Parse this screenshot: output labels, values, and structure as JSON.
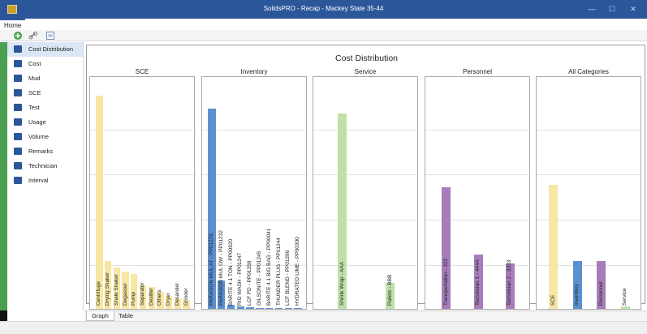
{
  "window": {
    "title": "SolidsPRO - Recap - Mackey State 35-44",
    "minimize": "—",
    "maximize": "☐",
    "close": "✕"
  },
  "ribbon": {
    "tab": "Home"
  },
  "toolbar": {
    "icons": [
      "add-icon",
      "link-icon",
      "view-icon"
    ]
  },
  "sidebar": {
    "items": [
      {
        "label": "Cost Distribution",
        "icon": "cost-distribution-icon",
        "color": "#2b579a",
        "selected": true
      },
      {
        "label": "Cost",
        "icon": "cost-icon",
        "color": "#2b579a",
        "selected": false
      },
      {
        "label": "Mud",
        "icon": "mud-funnel-icon",
        "color": "#2b579a",
        "selected": false
      },
      {
        "label": "SCE",
        "icon": "sce-grid-icon",
        "color": "#2b579a",
        "selected": false
      },
      {
        "label": "Test",
        "icon": "test-icon",
        "color": "#2b579a",
        "selected": false
      },
      {
        "label": "Usage",
        "icon": "usage-icon",
        "color": "#2b579a",
        "selected": false
      },
      {
        "label": "Volume",
        "icon": "volume-icon",
        "color": "#2b579a",
        "selected": false
      },
      {
        "label": "Remarks",
        "icon": "remarks-icon",
        "color": "#2b579a",
        "selected": false
      },
      {
        "label": "Technician",
        "icon": "technician-icon",
        "color": "#2b579a",
        "selected": false
      },
      {
        "label": "Interval",
        "icon": "interval-icon",
        "color": "#2b579a",
        "selected": false
      }
    ]
  },
  "bottom_tabs": [
    {
      "label": "Graph",
      "selected": true
    },
    {
      "label": "Table",
      "selected": false
    }
  ],
  "chart_data": {
    "type": "bar",
    "title": "Cost Distribution",
    "grid": true,
    "panels": [
      {
        "name": "SCE",
        "color": "#f7e7a3",
        "categories": [
          "Centrifuge",
          "Drying Shaker",
          "Shale Shaker",
          "Degasser",
          "Pump",
          "Separator",
          "Desilter",
          "Others",
          "Dryer",
          "Desander",
          "Grinder"
        ],
        "values": [
          98,
          22,
          19,
          17,
          16,
          11,
          10,
          8,
          6,
          5,
          4
        ]
      },
      {
        "name": "Inventory",
        "color": "#5b8fcf",
        "categories": [
          "PARAGON MUL AT - PP01229",
          "PARAGON MUL OW - PP01232",
          "BARITE 4.1 TON - PP00920",
          "RIG WASH - PP01247",
          "LCF FD - PP01258",
          "GILSONITE - PP01245",
          "BARITE 4.1 BIG BAG - PP00041",
          "THUNDER PLUG - PP01244",
          "LCF BLEND - PP01296",
          "HYDRATED LIME - PP00300"
        ],
        "values": [
          92,
          13,
          2,
          1,
          0.6,
          0.5,
          0.4,
          0.3,
          0.2,
          0.1
        ]
      },
      {
        "name": "Service",
        "color": "#bfe0a6",
        "categories": [
          "Shrink Wrap - AAA",
          "Pallets - BBB"
        ],
        "values": [
          90,
          12
        ]
      },
      {
        "name": "Personnel",
        "color": "#a67cba",
        "categories": [
          "Transportation - 222",
          "Technician 1 - 4444",
          "Technician 2 - 3333"
        ],
        "values": [
          56,
          25,
          21
        ]
      },
      {
        "name": "All Categories",
        "categories": [
          "SCE",
          "Inventory",
          "Personnel",
          "Service"
        ],
        "values": [
          57,
          22,
          22,
          1
        ],
        "colors": [
          "#f7e7a3",
          "#5b8fcf",
          "#a67cba",
          "#bfe0a6"
        ]
      }
    ]
  }
}
